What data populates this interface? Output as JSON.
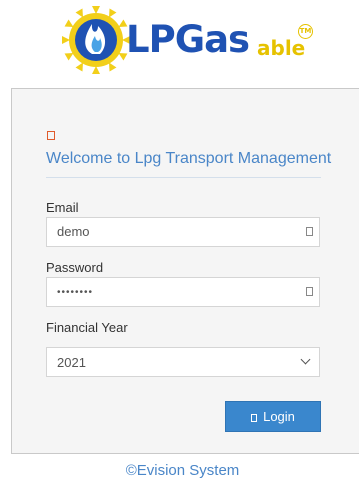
{
  "brand": {
    "lp": "LP",
    "gas": "Gas",
    "able": "able",
    "tm": "TM"
  },
  "colors": {
    "accent": "#3a87cd",
    "welcome": "#4a86c8",
    "logo_blue": "#1f52b3",
    "logo_yellow": "#e6c200",
    "icon_orange": "#e05a2b"
  },
  "form": {
    "welcome": "Welcome to Lpg Transport Management",
    "email_label": "Email",
    "email_value": "demo",
    "password_label": "Password",
    "password_masked": "••••••••",
    "fy_label": "Financial Year",
    "fy_value": "2021",
    "login_label": "Login"
  },
  "icons": {
    "header": "square-icon",
    "email": "user-icon",
    "password": "lock-icon",
    "login": "key-icon"
  },
  "footer": "©Evision System"
}
